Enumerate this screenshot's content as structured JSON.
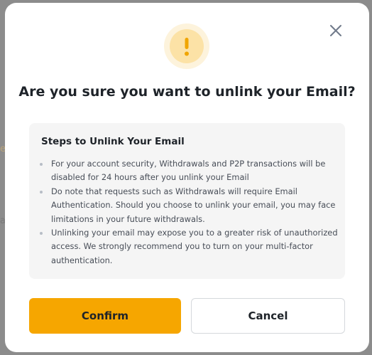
{
  "background": {
    "fragment_1": "e",
    "fragment_2": "a"
  },
  "dialog": {
    "title": "Are you sure you want to unlink your Email?",
    "icons": {
      "status": "warning-icon",
      "close": "close-icon"
    },
    "steps": {
      "heading": "Steps to Unlink Your Email",
      "items": [
        "For your account security, Withdrawals and P2P transactions will be disabled for 24 hours after you unlink your Email",
        "Do note that requests such as Withdrawals will require Email Authentication. Should you choose to unlink your email, you may face limitations in your future withdrawals.",
        "Unlinking your email may expose you to a greater risk of unauthorized access. We strongly recommend you to turn on your multi-factor authentication."
      ]
    },
    "buttons": {
      "confirm_label": "Confirm",
      "cancel_label": "Cancel"
    }
  },
  "colors": {
    "accent": "#f6a600",
    "warning_ring": "#fce2a6",
    "warning_mark": "#f0a500",
    "panel_bg": "#f5f5f5",
    "text_primary": "#1e2329",
    "text_secondary": "#474d57"
  }
}
